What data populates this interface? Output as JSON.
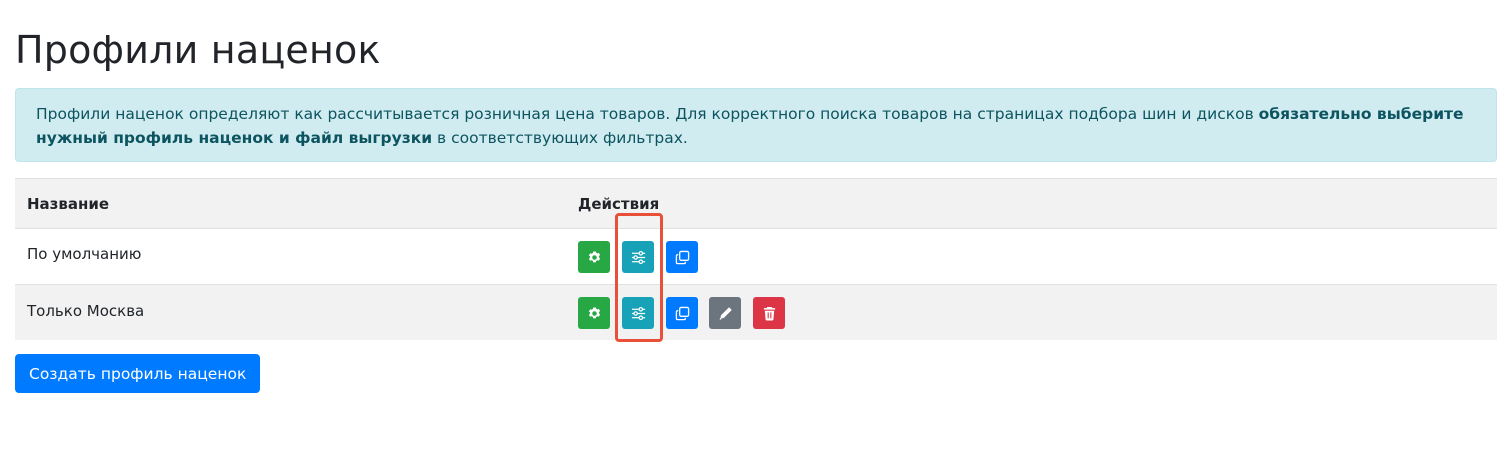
{
  "page": {
    "title": "Профили наценок"
  },
  "alert": {
    "text_plain": "Профили наценок определяют как рассчитывается розничная цена товаров. Для корректного поиска товаров на страницах подбора шин и дисков ",
    "text_bold": "обязательно выберите нужный профиль наценок и файл выгрузки",
    "text_tail": " в соответствующих фильтрах."
  },
  "table": {
    "columns": [
      "Название",
      "Действия"
    ],
    "rows": [
      {
        "name": "По умолчанию",
        "actions": [
          "settings",
          "sliders",
          "copy"
        ]
      },
      {
        "name": "Только Москва",
        "actions": [
          "settings",
          "sliders",
          "copy",
          "edit",
          "delete"
        ]
      }
    ]
  },
  "icons": {
    "settings": "gear-icon",
    "sliders": "sliders-icon",
    "copy": "copy-icon",
    "edit": "pencil-icon",
    "delete": "trash-icon"
  },
  "colors": {
    "settings": "#28a745",
    "sliders": "#17a2b8",
    "copy": "#007bff",
    "edit": "#6c757d",
    "delete": "#dc3545",
    "highlight": "#e8503a",
    "alert_bg": "#d1ecf1",
    "alert_text": "#0c5460"
  },
  "buttons": {
    "create_label": "Создать профиль наценок"
  }
}
